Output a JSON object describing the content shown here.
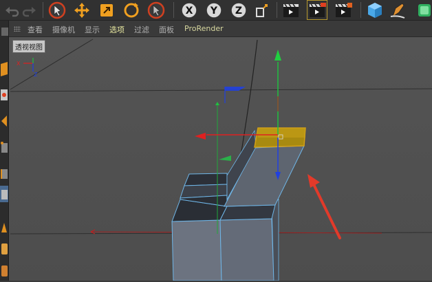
{
  "toolbar": {
    "buttons": [
      {
        "name": "undo-icon"
      },
      {
        "name": "redo-icon"
      },
      {
        "name": "live-selection-icon"
      },
      {
        "name": "move-icon"
      },
      {
        "name": "scale-icon"
      },
      {
        "name": "rotate-icon"
      },
      {
        "name": "recent-tool-icon"
      },
      {
        "name": "x-axis-lock-icon",
        "label": "X"
      },
      {
        "name": "y-axis-lock-icon",
        "label": "Y"
      },
      {
        "name": "z-axis-lock-icon",
        "label": "Z"
      },
      {
        "name": "coordinate-system-icon"
      },
      {
        "name": "render-view-icon"
      },
      {
        "name": "render-to-picture-viewer-icon"
      },
      {
        "name": "render-settings-icon"
      },
      {
        "name": "cube-icon"
      },
      {
        "name": "pen-icon"
      },
      {
        "name": "subdivision-icon"
      }
    ]
  },
  "menubar": {
    "items": [
      "查看",
      "摄像机",
      "显示",
      "选项",
      "过滤",
      "面板",
      "ProRender"
    ]
  },
  "viewport": {
    "label": "透视视图",
    "axis_labels": {
      "x": "X",
      "y": "Y",
      "z": "Z"
    }
  },
  "colors": {
    "x_axis": "#e02020",
    "y_axis": "#20c040",
    "z_axis": "#2040e0",
    "selection": "#d4a017",
    "annotation_arrow": "#e23a2a",
    "mesh_edge": "#6fb6e8"
  }
}
